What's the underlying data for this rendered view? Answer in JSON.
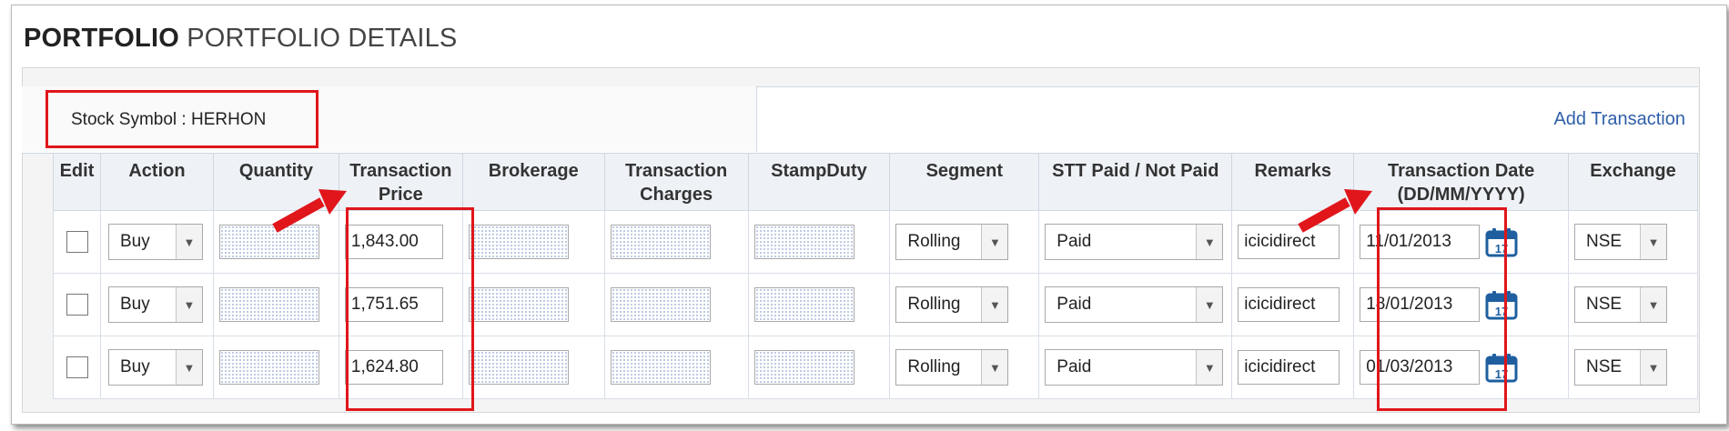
{
  "title": {
    "bold": "PORTFOLIO",
    "rest": "PORTFOLIO DETAILS"
  },
  "stock_symbol_label": "Stock Symbol : HERHON",
  "add_transaction": "Add Transaction",
  "columns": {
    "edit": "Edit",
    "action": "Action",
    "quantity": "Quantity",
    "price_l1": "Transaction",
    "price_l2": "Price",
    "brokerage": "Brokerage",
    "charges_l1": "Transaction",
    "charges_l2": "Charges",
    "stamp": "StampDuty",
    "segment": "Segment",
    "stt": "STT Paid / Not Paid",
    "remarks": "Remarks",
    "date_l1": "Transaction Date",
    "date_l2": "(DD/MM/YYYY)",
    "exchange": "Exchange"
  },
  "rows": [
    {
      "action": "Buy",
      "price": "1,843.00",
      "segment": "Rolling",
      "stt": "Paid",
      "remarks": "icicidirect",
      "date": "11/01/2013",
      "exchange": "NSE"
    },
    {
      "action": "Buy",
      "price": "1,751.65",
      "segment": "Rolling",
      "stt": "Paid",
      "remarks": "icicidirect",
      "date": "18/01/2013",
      "exchange": "NSE"
    },
    {
      "action": "Buy",
      "price": "1,624.80",
      "segment": "Rolling",
      "stt": "Paid",
      "remarks": "icicidirect",
      "date": "01/03/2013",
      "exchange": "NSE"
    }
  ],
  "calendar_day": "17",
  "colors": {
    "annotation_red": "#e0161b",
    "link_blue": "#2f5fa8",
    "calendar_blue": "#1f5fa0"
  }
}
